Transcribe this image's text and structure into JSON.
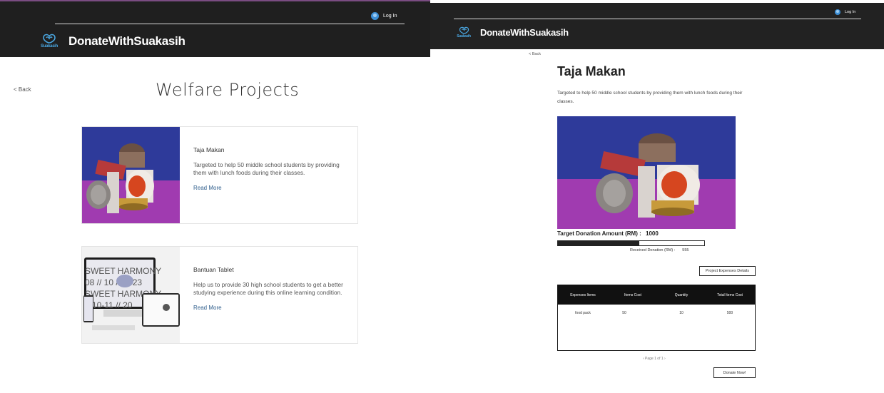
{
  "left": {
    "header": {
      "login_label": "Log In",
      "brand": "DonateWithSuakasih",
      "logo_text": "Suakasih"
    },
    "back_label": "< Back",
    "page_title": "Welfare Projects",
    "projects": [
      {
        "title": "Taja Makan",
        "description": "Targeted to help 50 middle school students by providing them with lunch foods during their classes.",
        "read_more": "Read More"
      },
      {
        "title": "Bantuan Tablet",
        "description": "Help us to provide 30 high school students to get a better studying experience during this online learning condition.",
        "read_more": "Read More"
      }
    ]
  },
  "right": {
    "header": {
      "login_label": "Log In",
      "brand": "DonateWithSuakasih",
      "logo_text": "Suakasih"
    },
    "back_label": "< Back",
    "project_title": "Taja Makan",
    "project_description": "Targeted to help 50 middle school students by providing them with lunch foods during their classes.",
    "target_label": "Target Donation Amount (RM) :",
    "target_value": "1000",
    "received_label": "Received Donation (RM) :",
    "received_value": "555",
    "progress_fraction": 0.555,
    "expenses_button": "Project Expenses Details",
    "table": {
      "headers": [
        "Expenses Items",
        "Items Cost",
        "Quantity",
        "Total Items Cost"
      ],
      "rows": [
        [
          "food pack",
          "50",
          "10",
          "500"
        ]
      ]
    },
    "pager": "‹  Page 1 of 1  ›",
    "donate_button": "Donate Now!"
  },
  "colors": {
    "header_bg": "#1f1f1f",
    "accent_blue": "#4aa6e0",
    "link_blue": "#2f5e8c"
  }
}
